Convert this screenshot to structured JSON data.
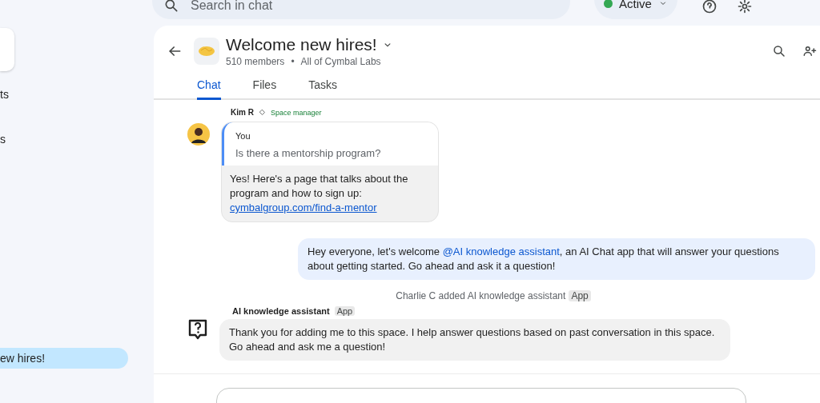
{
  "top_bar": {
    "search": {
      "placeholder": "Search in chat"
    },
    "status": {
      "label": "Active",
      "color": "#34a853"
    }
  },
  "sidebar": {
    "items": [
      {
        "label": "ts",
        "selected": false
      },
      {
        "label": "s",
        "selected": false
      },
      {
        "label": "ew hires!",
        "selected": true
      }
    ]
  },
  "space": {
    "title": "Welcome new hires!",
    "members": "510 members",
    "separator": "•",
    "audience": "All of Cymbal Labs"
  },
  "tabs": [
    {
      "label": "Chat",
      "selected": true
    },
    {
      "label": "Files",
      "selected": false
    },
    {
      "label": "Tasks",
      "selected": false
    }
  ],
  "messages": [
    {
      "kind": "reply",
      "sender": "Kim R",
      "role": "Space manager",
      "quote_author": "You",
      "quote_text": "Is there a mentorship program?",
      "text": "Yes! Here's a page that talks about the program and how to sign up:",
      "link": "cymbalgroup.com/find-a-mentor"
    },
    {
      "kind": "own",
      "text_before": "Hey everyone, let's welcome ",
      "mention": "@AI knowledge assistant",
      "text_after": ", an AI Chat app that will answer your questions about getting started.  Go ahead and ask it a question!"
    },
    {
      "kind": "event",
      "text": "Charlie C added AI knowledge assistant",
      "badge": "App"
    },
    {
      "kind": "app",
      "sender": "AI knowledge assistant",
      "badge": "App",
      "text": "Thank you for adding me to this space. I help answer questions based on past conversation in this space. Go ahead and ask me a question!"
    }
  ]
}
